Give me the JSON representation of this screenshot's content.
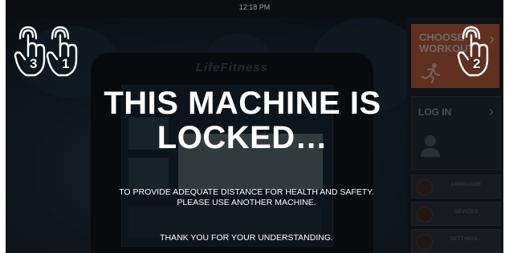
{
  "status_bar": {
    "time": "12:18 PM"
  },
  "console": {
    "brand": "LifeFitness"
  },
  "lock_message": {
    "title": "THIS MACHINE IS LOCKED…",
    "body_line1": "TO PROVIDE ADEQUATE DISTANCE FOR HEALTH AND SAFETY.",
    "body_line2": "PLEASE USE ANOTHER MACHINE.",
    "thanks": "THANK YOU FOR YOUR UNDERSTANDING."
  },
  "right_panel": {
    "choose_workout": "CHOOSE WORKOUT",
    "log_in": "LOG IN",
    "buttons": [
      "LANGUAGE",
      "DEVICES",
      "SETTINGS..."
    ]
  },
  "gestures": {
    "left_numbers": [
      "3",
      "1"
    ],
    "right_number": "2"
  },
  "colors": {
    "accent": "#b65a3d",
    "overlay_text": "#ffffff"
  }
}
